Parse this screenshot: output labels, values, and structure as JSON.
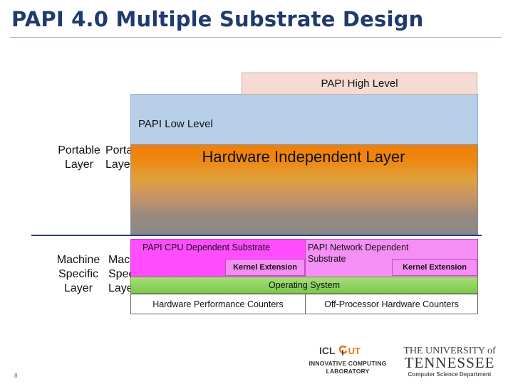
{
  "slide": {
    "title": "PAPI 4.0 Multiple Substrate Design",
    "number": "8"
  },
  "side_labels": {
    "portable_left": "Portable\nLayer",
    "portable_right": "Portable\nLayer",
    "machine_left": "Machine\nSpecific\nLayer",
    "machine_right": "Machine\nSpecific\nLayer"
  },
  "diagram": {
    "high_level": "PAPI High Level",
    "low_level": "PAPI Low Level",
    "hardware_independent": "Hardware Independent Layer",
    "cpu_substrate": "PAPI CPU Dependent Substrate",
    "cpu_kernel_extension": "Kernel Extension",
    "network_substrate": "PAPI Network Dependent Substrate",
    "network_kernel_extension": "Kernel Extension",
    "operating_system": "Operating System",
    "hw_counters": "Hardware Performance Counters",
    "offproc_counters": "Off-Processor Hardware Counters"
  },
  "colors": {
    "title": "#1f3a6e",
    "high_level": "#f6dbd2",
    "low_level": "#b8cfe9",
    "hardware_independent_top": "#f07f0c",
    "hardware_independent_bottom": "#8a8986",
    "cpu_substrate": "#ff4dff",
    "network_substrate": "#f58ef5",
    "operating_system": "#7dc64b",
    "boundary_line": "#2b3a8c"
  },
  "logos": {
    "icl_name": "ICL",
    "icl_mark": "UT",
    "icl_line1": "INNOVATIVE COMPUTING",
    "icl_line2": "LABORATORY",
    "ut_line1": "THE UNIVERSITY of",
    "ut_line2": "TENNESSEE",
    "ut_line3": "Computer Science Department"
  }
}
